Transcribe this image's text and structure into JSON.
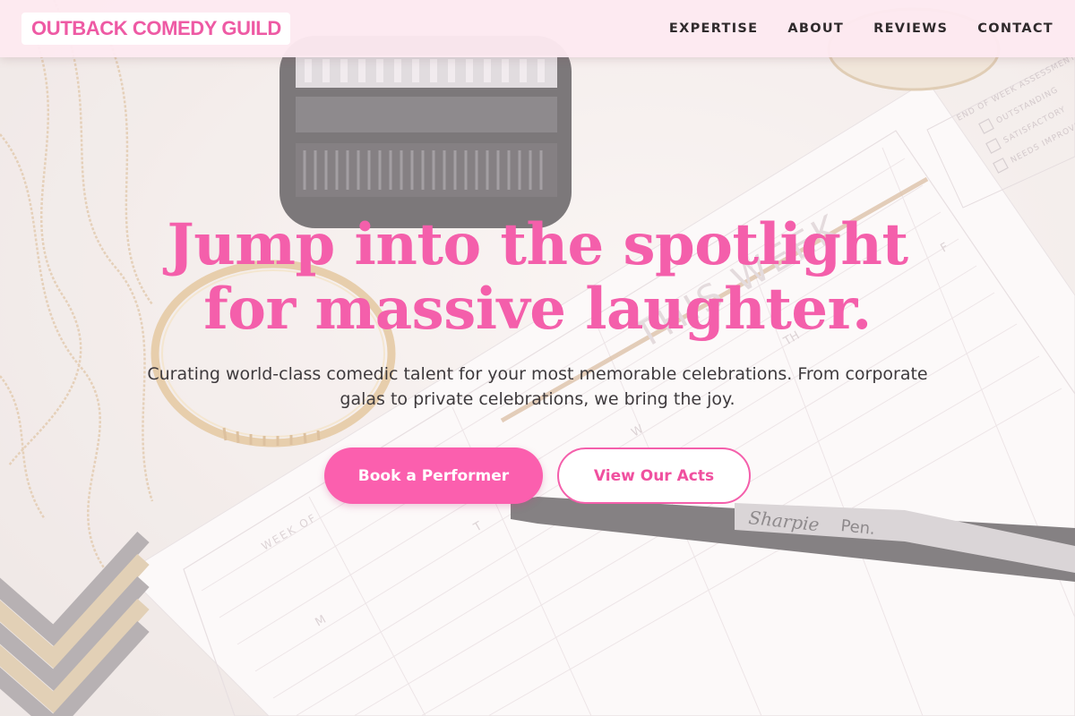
{
  "brand": {
    "name": "OUTBACK COMEDY GUILD",
    "color": "#ee5aa4"
  },
  "nav": {
    "items": [
      {
        "label": "EXPERTISE"
      },
      {
        "label": "ABOUT"
      },
      {
        "label": "REVIEWS"
      },
      {
        "label": "CONTACT"
      }
    ]
  },
  "hero": {
    "headline_line1": "Jump into the spotlight",
    "headline_line2": "for massive laughter.",
    "subtext": "Curating world-class comedic talent for your most memorable celebrations. From corporate galas to private celebrations, we bring the joy.",
    "primary_button": "Book a Performer",
    "secondary_button": "View Our Acts"
  },
  "background_photo": {
    "planner_labels": [
      "END OF WEEK ASSESSMENT",
      "OUTSTANDING",
      "SATISFACTORY",
      "NEEDS IMPROVEMENT",
      "THIS WEEK",
      "WEEK OF",
      "M",
      "T",
      "W",
      "TH",
      "F"
    ],
    "pen_brand": "Sharpie",
    "pen_type": "Pen."
  },
  "colors": {
    "accent": "#f45fab",
    "button_primary": "#fb5fae",
    "header_bg": "#fde9f0",
    "text_dark": "#2f2a2c"
  }
}
